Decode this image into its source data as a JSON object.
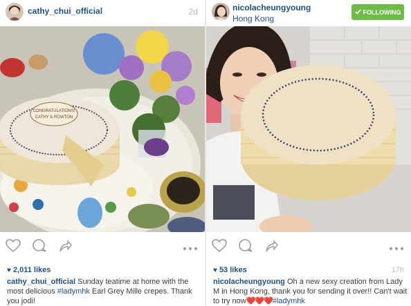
{
  "post1": {
    "username": "cathy_chui_official",
    "time": "2d",
    "photo_text": "CONGRATULATIONS! CATHY & ROWTON",
    "likes": "2,011 likes",
    "caption_user": "cathy_chui_official",
    "caption_pre": " Sunday teatime at home with the most delicious ",
    "caption_tag": "#ladymhk",
    "caption_post": " Earl Grey Mille crepes. Thank you jodi!"
  },
  "post2": {
    "username": "nicolacheungyoung",
    "location": "Hong Kong",
    "follow_label": "FOLLOWING",
    "time": "17h",
    "likes": "53 likes",
    "caption_user": "nicolacheungyoung",
    "caption_pre": " Oh a new sexy creation from Lady M in Hong Kong, thank you for sending it over!! Can't wait to try now",
    "caption_hearts": "❤️❤️❤️",
    "caption_tag": "#ladymhk"
  },
  "colors": {
    "link": "#1f4f82",
    "follow_green": "#6fbb48",
    "muted": "#b8b8b8"
  },
  "icons": [
    "heart-outline-icon",
    "comment-icon",
    "share-arrow-icon",
    "more-dots-icon",
    "check-icon",
    "likes-heart-icon"
  ]
}
